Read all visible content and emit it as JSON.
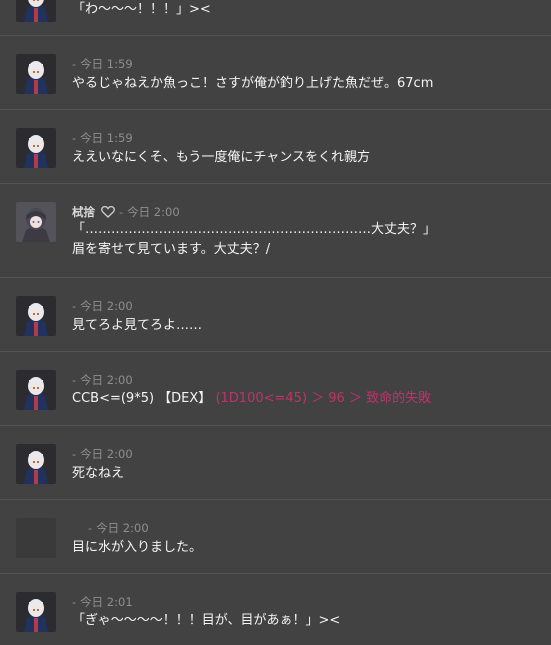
{
  "messages": [
    {
      "id": "m0",
      "avatar": "white-hair",
      "name": "",
      "time": "",
      "text": "「わ～～～！！！」><"
    },
    {
      "id": "m1",
      "avatar": "white-hair",
      "name": "",
      "time": "今日 1:59",
      "text": "やるじゃねえか魚っこ！さすが俺が釣り上げた魚だぜ。67cm"
    },
    {
      "id": "m2",
      "avatar": "white-hair",
      "name": "",
      "time": "今日 1:59",
      "text": "ええいなにくそ、もう一度俺にチャンスをくれ親方"
    },
    {
      "id": "m3",
      "avatar": "dark-hair",
      "name": "栻捨",
      "time": "今日 2:00",
      "lines": [
        "「…………………………………………………………大丈夫？」",
        "眉を寄せて見ています。大丈夫？/"
      ]
    },
    {
      "id": "m4",
      "avatar": "white-hair",
      "name": "",
      "time": "今日 2:00",
      "text": "見てろよ見てろよ……"
    },
    {
      "id": "m5",
      "avatar": "white-hair",
      "name": "",
      "time": "今日 2:00",
      "text": "CCB<=(9*5) 【DEX】",
      "dice": "(1D100<=45) ＞ 96 ＞ 致命的失敗"
    },
    {
      "id": "m6",
      "avatar": "white-hair",
      "name": "",
      "time": "今日 2:00",
      "text": "死なねえ"
    },
    {
      "id": "m7",
      "avatar": "blank",
      "name": "",
      "time": "今日 2:00",
      "text": "目に水が入りました。"
    },
    {
      "id": "m8",
      "avatar": "white-hair",
      "name": "",
      "time": "今日 2:01",
      "text": "「ぎゃ～～～～！！！目が、目があぁ！」><"
    }
  ],
  "meta_separator": "-",
  "colors": {
    "background": "#424242",
    "divider": "#555555",
    "dice_result": "#c0326a",
    "timestamp": "#8e8e8e"
  }
}
